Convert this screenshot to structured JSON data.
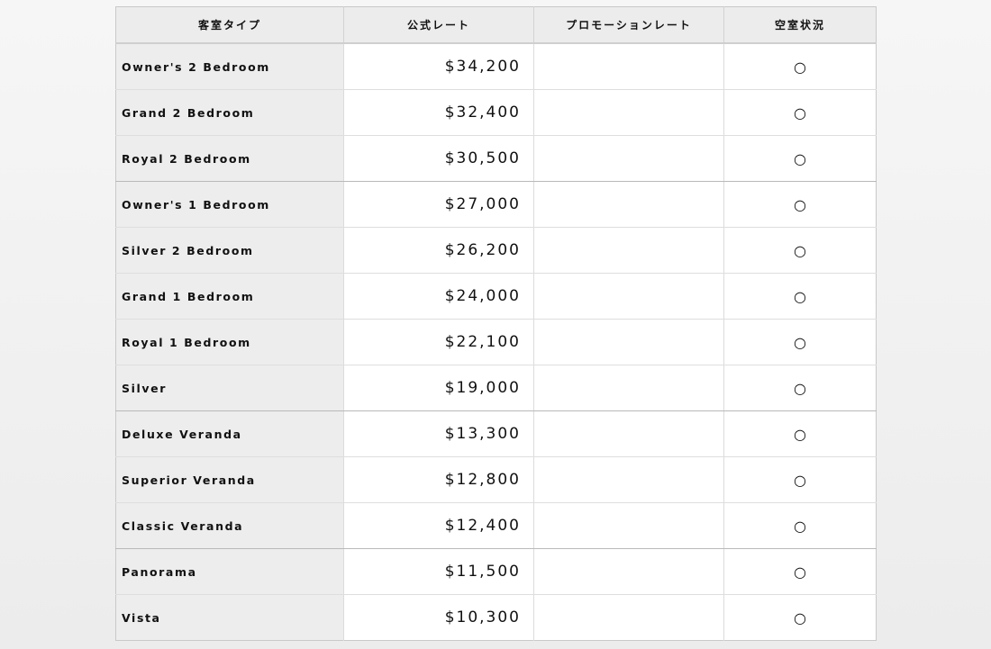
{
  "headers": {
    "room_type": "客室タイプ",
    "official_rate": "公式レート",
    "promotion_rate": "プロモーションレート",
    "availability": "空室状況"
  },
  "rows": [
    {
      "room": "Owner's 2 Bedroom",
      "rate": "$34,200",
      "promo": "",
      "available": "○"
    },
    {
      "room": "Grand 2 Bedroom",
      "rate": "$32,400",
      "promo": "",
      "available": "○"
    },
    {
      "room": "Royal 2 Bedroom",
      "rate": "$30,500",
      "promo": "",
      "available": "○"
    },
    {
      "room": "Owner's 1 Bedroom",
      "rate": "$27,000",
      "promo": "",
      "available": "○"
    },
    {
      "room": "Silver 2 Bedroom",
      "rate": "$26,200",
      "promo": "",
      "available": "○"
    },
    {
      "room": "Grand 1 Bedroom",
      "rate": "$24,000",
      "promo": "",
      "available": "○"
    },
    {
      "room": "Royal 1 Bedroom",
      "rate": "$22,100",
      "promo": "",
      "available": "○"
    },
    {
      "room": "Silver",
      "rate": "$19,000",
      "promo": "",
      "available": "○"
    },
    {
      "room": "Deluxe Veranda",
      "rate": "$13,300",
      "promo": "",
      "available": "○"
    },
    {
      "room": "Superior Veranda",
      "rate": "$12,800",
      "promo": "",
      "available": "○"
    },
    {
      "room": "Classic Veranda",
      "rate": "$12,400",
      "promo": "",
      "available": "○"
    },
    {
      "room": "Panorama",
      "rate": "$11,500",
      "promo": "",
      "available": "○"
    },
    {
      "room": "Vista",
      "rate": "$10,300",
      "promo": "",
      "available": "○"
    }
  ]
}
